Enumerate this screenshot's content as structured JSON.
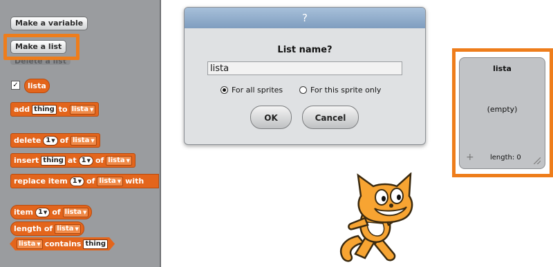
{
  "palette": {
    "make_variable": "Make a variable",
    "make_list": "Make a list",
    "delete_list": "Delete a list",
    "list_name": "lista",
    "add_block": {
      "word1": "add",
      "arg": "thing",
      "word2": "to",
      "list": "lista"
    },
    "delete_block": {
      "word1": "delete",
      "num": "1",
      "word2": "of",
      "list": "lista"
    },
    "insert_block": {
      "word1": "insert",
      "arg": "thing",
      "word2": "at",
      "num": "1",
      "word3": "of",
      "list": "lista"
    },
    "replace_block": {
      "word1": "replace item",
      "num": "1",
      "word2": "of",
      "list": "lista",
      "word3": "with"
    },
    "item_block": {
      "word1": "item",
      "num": "1",
      "word2": "of",
      "list": "lista"
    },
    "length_block": {
      "word1": "length of",
      "list": "lista"
    },
    "contains_block": {
      "list": "lista",
      "word1": "contains",
      "arg": "thing"
    }
  },
  "dialog": {
    "title": "?",
    "prompt": "List name?",
    "input_value": "lista",
    "radio_all": "For all sprites",
    "radio_this": "For this sprite only",
    "ok": "OK",
    "cancel": "Cancel"
  },
  "watcher": {
    "title": "lista",
    "empty": "(empty)",
    "plus": "+",
    "length": "length: 0"
  },
  "colors": {
    "accent": "#ee7d1b",
    "list_block": "#e3651c",
    "palette_bg": "#9a9c9f"
  }
}
